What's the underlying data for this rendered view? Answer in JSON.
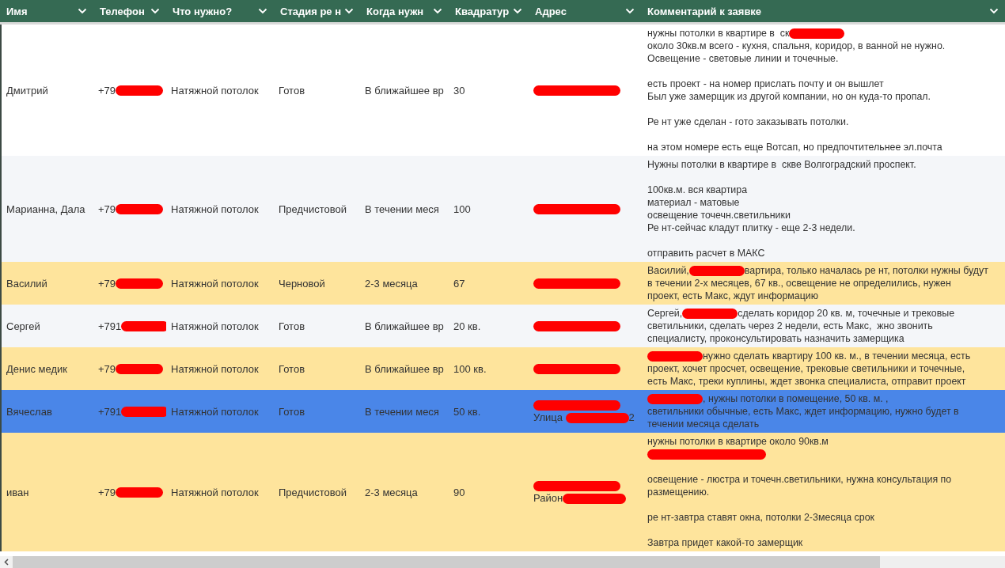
{
  "columns": [
    {
      "label": "Имя"
    },
    {
      "label": "Телефон"
    },
    {
      "label": "Что нужно?"
    },
    {
      "label": "Стадия ре н"
    },
    {
      "label": "Когда нужн"
    },
    {
      "label": "Квадратур"
    },
    {
      "label": "Адрес"
    },
    {
      "label": "Комментарий к заявке"
    }
  ],
  "rows": [
    {
      "color": "#ffffff",
      "name": "Дмитрий",
      "phone": [
        {
          "kind": "text",
          "text": "+79"
        },
        {
          "kind": "redaction"
        }
      ],
      "need": "Натяжной потолок",
      "stage": "Готов",
      "when": "В ближайшее вр",
      "area": "30",
      "address": [
        [
          {
            "kind": "redaction"
          }
        ]
      ],
      "comment": [
        [
          [
            {
              "kind": "text",
              "text": "нужны потолки в квартире в  ск"
            },
            {
              "kind": "redaction"
            }
          ],
          [
            {
              "kind": "text",
              "text": "около 30кв.м всего - кухня, спальня, коридор, в ванной не нужно."
            }
          ],
          [
            {
              "kind": "text",
              "text": "Освещение - световые линии и точечные."
            }
          ]
        ],
        [
          [
            {
              "kind": "text",
              "text": "есть проект - на номер прислать почту и он вышлет"
            }
          ],
          [
            {
              "kind": "text",
              "text": "Был уже замерщик из другой компании, но он куда-то пропал."
            }
          ]
        ],
        [
          [
            {
              "kind": "text",
              "text": "Ре нт уже сделан - гото заказывать потолки."
            }
          ]
        ],
        [
          [
            {
              "kind": "text",
              "text": "на этом номере есть еще Вотсап, но предпочтительнее эл.почта"
            }
          ]
        ]
      ]
    },
    {
      "color": "#f4f6f9",
      "name": "Марианна, Дала",
      "phone": [
        {
          "kind": "text",
          "text": "+79"
        },
        {
          "kind": "redaction"
        }
      ],
      "need": "Натяжной потолок",
      "stage": "Предчистовой",
      "when": "В течении меся",
      "area": "100",
      "address": [
        [
          {
            "kind": "redaction"
          }
        ]
      ],
      "comment": [
        [
          [
            {
              "kind": "text",
              "text": "Нужны потолки в квартире в  скве Волгоградский проспект."
            }
          ]
        ],
        [
          [
            {
              "kind": "text",
              "text": "100кв.м. вся квартира"
            }
          ],
          [
            {
              "kind": "text",
              "text": "материал - матовые"
            }
          ],
          [
            {
              "kind": "text",
              "text": "освещение точечн.светильники"
            }
          ],
          [
            {
              "kind": "text",
              "text": "Ре нт-сейчас кладут плитку - еще 2-3 недели."
            }
          ]
        ],
        [
          [
            {
              "kind": "text",
              "text": "отправить расчет в МАКС"
            }
          ]
        ]
      ]
    },
    {
      "color": "#fee49c",
      "name": "Василий",
      "phone": [
        {
          "kind": "text",
          "text": "+79"
        },
        {
          "kind": "redaction"
        }
      ],
      "need": "Натяжной потолок",
      "stage": "Черновой",
      "when": "2-3 месяца",
      "area": "67",
      "address": [
        [
          {
            "kind": "redaction"
          }
        ]
      ],
      "comment": [
        [
          [
            {
              "kind": "text",
              "text": "Василий,"
            },
            {
              "kind": "redaction"
            },
            {
              "kind": "text",
              "text": "вартира, только началась ре нт, потолки нужны будут"
            }
          ],
          [
            {
              "kind": "text",
              "text": "в течении 2-х месяцев, 67 кв., освещение не определились, нужен"
            }
          ],
          [
            {
              "kind": "text",
              "text": "проект, есть Макс, ждут информацию"
            }
          ]
        ]
      ]
    },
    {
      "color": "#f4f6f9",
      "name": "Сергей",
      "phone": [
        {
          "kind": "text",
          "text": "+791"
        },
        {
          "kind": "redaction"
        }
      ],
      "need": "Натяжной потолок",
      "stage": "Готов",
      "when": "В ближайшее вр",
      "area": "20 кв.",
      "address": [
        [
          {
            "kind": "redaction"
          }
        ]
      ],
      "comment": [
        [
          [
            {
              "kind": "text",
              "text": "Сергей,"
            },
            {
              "kind": "redaction"
            },
            {
              "kind": "text",
              "text": "сделать коридор 20 кв. м, точечные и трековые"
            }
          ],
          [
            {
              "kind": "text",
              "text": "светильники, сделать через 2 недели, есть Макс,  жно звонить"
            }
          ],
          [
            {
              "kind": "text",
              "text": "специалисту, проконсультировать назначить замерщика"
            }
          ]
        ]
      ]
    },
    {
      "color": "#fee49c",
      "name": "Денис медик",
      "phone": [
        {
          "kind": "text",
          "text": "+79"
        },
        {
          "kind": "redaction"
        }
      ],
      "need": "Натяжной потолок",
      "stage": "Готов",
      "when": "В ближайшее вр",
      "area": "100 кв.",
      "address": [
        [
          {
            "kind": "redaction"
          }
        ]
      ],
      "comment": [
        [
          [
            {
              "kind": "redaction"
            },
            {
              "kind": "text",
              "text": "нужно сделать квартиру 100 кв. м., в течении месяца, есть"
            }
          ],
          [
            {
              "kind": "text",
              "text": "проект, хочет просчет, освещение, трековые светильники и точечные,"
            }
          ],
          [
            {
              "kind": "text",
              "text": "есть Макс, треки куплины, ждет звонка специалиста, отправит проект"
            }
          ]
        ]
      ]
    },
    {
      "color": "#4a86e8",
      "name": "Вячеслав",
      "phone": [
        {
          "kind": "text",
          "text": "+791"
        },
        {
          "kind": "redaction"
        }
      ],
      "need": "Натяжной потолок",
      "stage": "Готов",
      "when": "В течении меся",
      "area": "50 кв.",
      "address": [
        [
          {
            "kind": "redaction"
          }
        ],
        [
          {
            "kind": "text",
            "text": "Улица "
          },
          {
            "kind": "redaction"
          },
          {
            "kind": "text",
            "text": "2"
          }
        ]
      ],
      "comment": [
        [
          [
            {
              "kind": "redaction"
            },
            {
              "kind": "text",
              "text": ", нужны потолки в помещение, 50 кв. м. ,"
            }
          ],
          [
            {
              "kind": "text",
              "text": "светильники обычные, есть Макс, ждет информацию, нужно будет в"
            }
          ],
          [
            {
              "kind": "text",
              "text": "течении месяца сделать"
            }
          ]
        ]
      ]
    },
    {
      "color": "#fee49c",
      "name": "иван",
      "phone": [
        {
          "kind": "text",
          "text": "+79"
        },
        {
          "kind": "redaction"
        }
      ],
      "need": "Натяжной потолок",
      "stage": "Предчистовой",
      "when": "2-3 месяца",
      "area": "90",
      "address": [
        [
          {
            "kind": "redaction"
          }
        ],
        [
          {
            "kind": "text",
            "text": "Район"
          },
          {
            "kind": "redaction"
          }
        ]
      ],
      "comment": [
        [
          [
            {
              "kind": "text",
              "text": "нужны потолки в квартире около 90кв.м"
            }
          ],
          [
            {
              "kind": "redaction"
            }
          ]
        ],
        [
          [
            {
              "kind": "text",
              "text": "освещение - люстра и точечн.светильники, нужна консультация по"
            }
          ],
          [
            {
              "kind": "text",
              "text": "размещению."
            }
          ]
        ],
        [
          [
            {
              "kind": "text",
              "text": "ре нт-завтра ставят окна, потолки 2-3месяца срок"
            }
          ]
        ],
        [
          [
            {
              "kind": "text",
              "text": "Завтра придет какой-то замерщик"
            }
          ]
        ]
      ]
    }
  ]
}
